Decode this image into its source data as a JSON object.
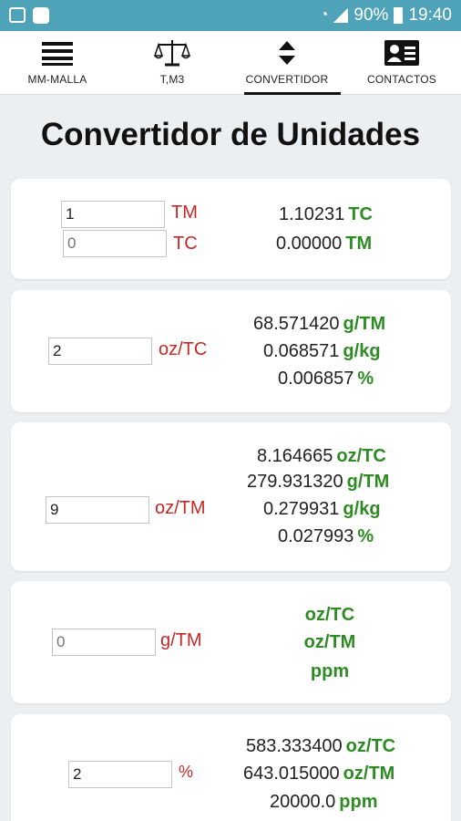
{
  "status_bar": {
    "battery": "90%",
    "time": "19:40"
  },
  "tabs": [
    {
      "label": "MM-MALLA",
      "icon": "menu-icon"
    },
    {
      "label": "T,M3",
      "icon": "balance-scale-icon"
    },
    {
      "label": "CONVERTIDOR",
      "icon": "sort-arrows-icon",
      "active": true
    },
    {
      "label": "CONTACTOS",
      "icon": "contact-card-icon"
    }
  ],
  "title": "Convertidor de Unidades",
  "cards": {
    "c1": {
      "inputs": [
        {
          "value": "1",
          "unit": "TM"
        },
        {
          "value": "",
          "placeholder": "0",
          "unit": "TC"
        }
      ],
      "results": [
        {
          "value": "1.10231",
          "unit": "TC"
        },
        {
          "value": "0.00000",
          "unit": "TM"
        }
      ]
    },
    "c2": {
      "input": {
        "value": "2",
        "unit": "oz/TC"
      },
      "results": [
        {
          "value": "68.571420",
          "unit": "g/TM"
        },
        {
          "value": "0.068571",
          "unit": "g/kg"
        },
        {
          "value": "0.006857",
          "unit": "%"
        }
      ]
    },
    "c3": {
      "input": {
        "value": "9",
        "unit": "oz/TM"
      },
      "results": [
        {
          "value": "8.164665",
          "unit": "oz/TC"
        },
        {
          "value": "279.931320",
          "unit": "g/TM"
        },
        {
          "value": "0.279931",
          "unit": "g/kg"
        },
        {
          "value": "0.027993",
          "unit": "%"
        }
      ]
    },
    "c4": {
      "input": {
        "value": "",
        "placeholder": "0",
        "unit": "g/TM"
      },
      "results": [
        {
          "unit": "oz/TC"
        },
        {
          "unit": "oz/TM"
        },
        {
          "unit": "ppm"
        }
      ]
    },
    "c5": {
      "input": {
        "value": "2",
        "unit": "%"
      },
      "results": [
        {
          "value": "583.333400",
          "unit": "oz/TC"
        },
        {
          "value": "643.015000",
          "unit": "oz/TM"
        },
        {
          "value": "20000.0",
          "unit": "ppm"
        }
      ]
    }
  },
  "colors": {
    "status_bar": "#4fa3b8",
    "unit_input": "#c62828",
    "unit_result": "#2e8b23",
    "background": "#eceff1"
  }
}
